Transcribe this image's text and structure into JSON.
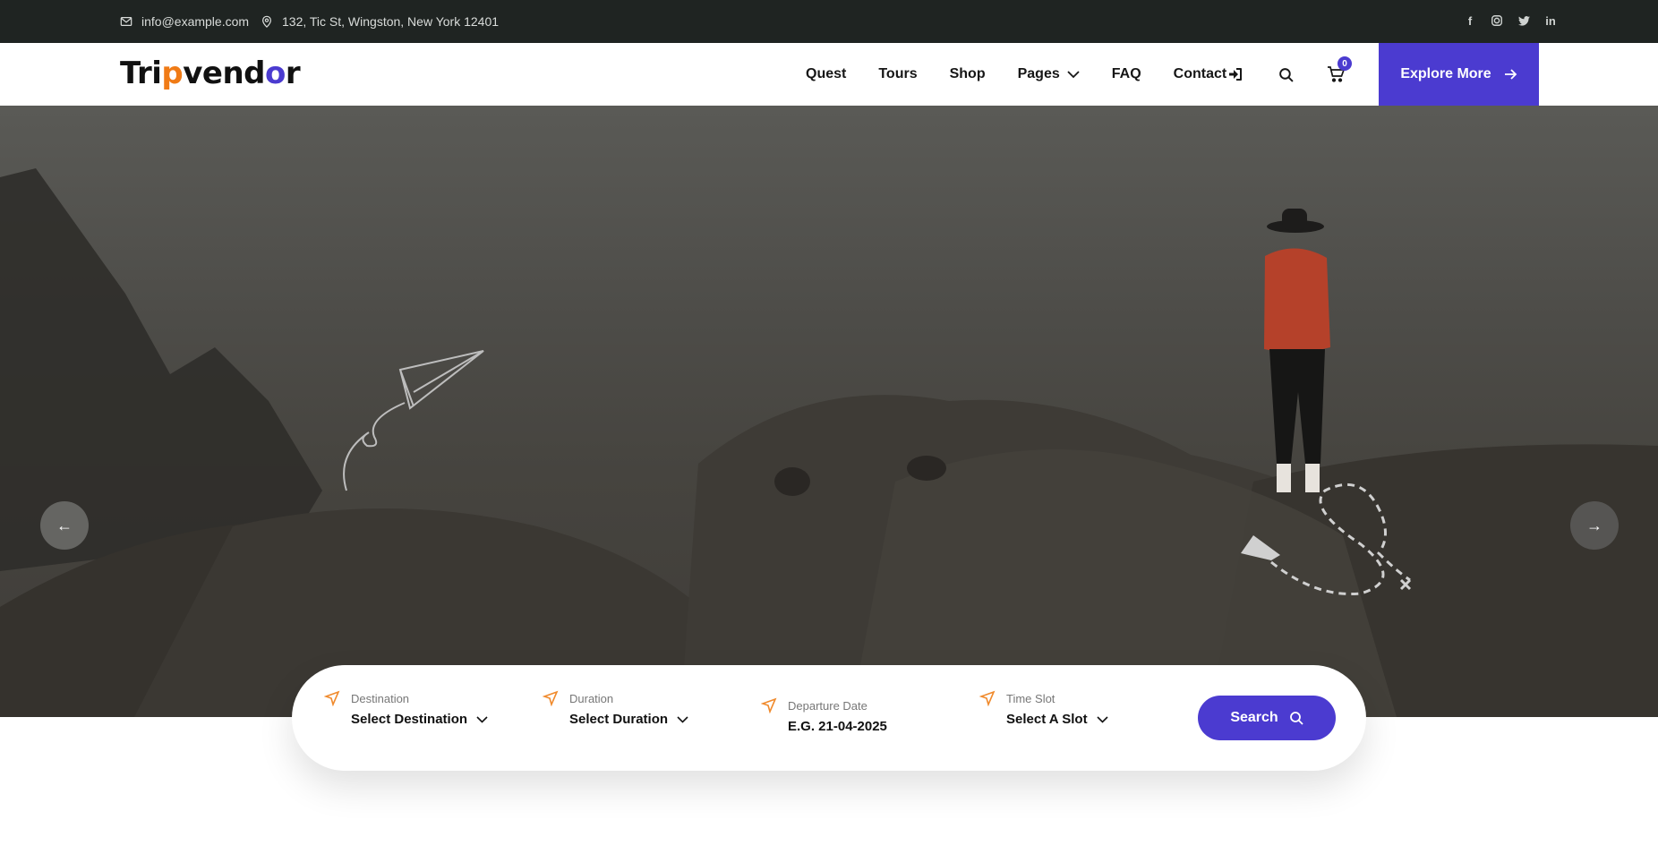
{
  "topbar": {
    "email": "info@example.com",
    "address": "132, Tic St, Wingston, New York 12401",
    "social": [
      "facebook-icon",
      "instagram-icon",
      "twitter-icon",
      "linkedin-icon"
    ]
  },
  "header": {
    "logo": {
      "part1": "Tri",
      "part2": "p",
      "part3": "vend",
      "part4": "o",
      "part5": "r"
    },
    "nav": [
      "Quest",
      "Tours",
      "Shop",
      "Pages",
      "FAQ",
      "Contact"
    ],
    "cart_count": "0",
    "cta": "Explore More"
  },
  "colors": {
    "accent": "#4b3bd0",
    "orange": "#f07b16",
    "topbar": "#1f2422"
  },
  "search": {
    "destination": {
      "label": "Destination",
      "value": "Select Destination"
    },
    "duration": {
      "label": "Duration",
      "value": "Select Duration"
    },
    "date": {
      "label": "Departure Date",
      "value": "E.G. 21-04-2025"
    },
    "slot": {
      "label": "Time Slot",
      "value": "Select A Slot"
    },
    "button": "Search"
  }
}
